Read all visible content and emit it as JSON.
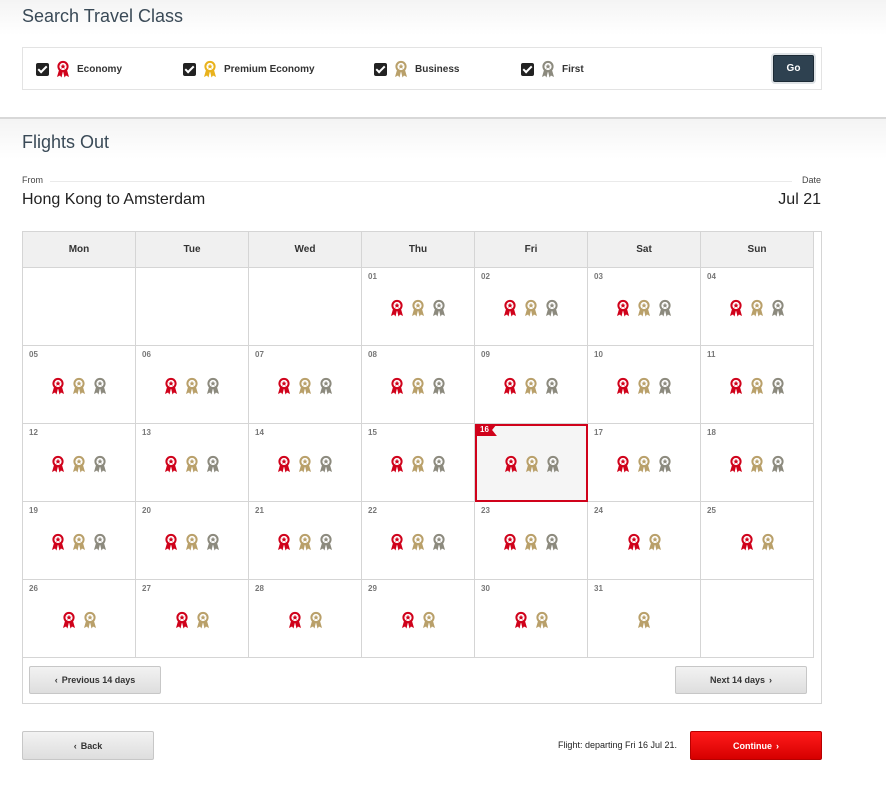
{
  "travel_class": {
    "title": "Search Travel Class",
    "options": [
      {
        "label": "Economy",
        "checked": true,
        "medal": "economy"
      },
      {
        "label": "Premium Economy",
        "checked": true,
        "medal": "premium"
      },
      {
        "label": "Business",
        "checked": true,
        "medal": "business"
      },
      {
        "label": "First",
        "checked": true,
        "medal": "first"
      }
    ],
    "go_label": "Go"
  },
  "flights": {
    "title": "Flights Out",
    "from_label": "From",
    "date_label": "Date",
    "route": "Hong Kong to Amsterdam",
    "month": "Jul 21"
  },
  "calendar": {
    "weekdays": [
      "Mon",
      "Tue",
      "Wed",
      "Thu",
      "Fri",
      "Sat",
      "Sun"
    ],
    "first_weekday_index": 3,
    "selected_day": "16",
    "days": [
      {
        "day": "01",
        "classes": [
          "economy",
          "business",
          "first"
        ]
      },
      {
        "day": "02",
        "classes": [
          "economy",
          "business",
          "first"
        ]
      },
      {
        "day": "03",
        "classes": [
          "economy",
          "business",
          "first"
        ]
      },
      {
        "day": "04",
        "classes": [
          "economy",
          "business",
          "first"
        ]
      },
      {
        "day": "05",
        "classes": [
          "economy",
          "business",
          "first"
        ]
      },
      {
        "day": "06",
        "classes": [
          "economy",
          "business",
          "first"
        ]
      },
      {
        "day": "07",
        "classes": [
          "economy",
          "business",
          "first"
        ]
      },
      {
        "day": "08",
        "classes": [
          "economy",
          "business",
          "first"
        ]
      },
      {
        "day": "09",
        "classes": [
          "economy",
          "business",
          "first"
        ]
      },
      {
        "day": "10",
        "classes": [
          "economy",
          "business",
          "first"
        ]
      },
      {
        "day": "11",
        "classes": [
          "economy",
          "business",
          "first"
        ]
      },
      {
        "day": "12",
        "classes": [
          "economy",
          "business",
          "first"
        ]
      },
      {
        "day": "13",
        "classes": [
          "economy",
          "business",
          "first"
        ]
      },
      {
        "day": "14",
        "classes": [
          "economy",
          "business",
          "first"
        ]
      },
      {
        "day": "15",
        "classes": [
          "economy",
          "business",
          "first"
        ]
      },
      {
        "day": "16",
        "classes": [
          "economy",
          "business",
          "first"
        ]
      },
      {
        "day": "17",
        "classes": [
          "economy",
          "business",
          "first"
        ]
      },
      {
        "day": "18",
        "classes": [
          "economy",
          "business",
          "first"
        ]
      },
      {
        "day": "19",
        "classes": [
          "economy",
          "business",
          "first"
        ]
      },
      {
        "day": "20",
        "classes": [
          "economy",
          "business",
          "first"
        ]
      },
      {
        "day": "21",
        "classes": [
          "economy",
          "business",
          "first"
        ]
      },
      {
        "day": "22",
        "classes": [
          "economy",
          "business",
          "first"
        ]
      },
      {
        "day": "23",
        "classes": [
          "economy",
          "business",
          "first"
        ]
      },
      {
        "day": "24",
        "classes": [
          "economy",
          "business"
        ]
      },
      {
        "day": "25",
        "classes": [
          "economy",
          "business"
        ]
      },
      {
        "day": "26",
        "classes": [
          "economy",
          "business"
        ]
      },
      {
        "day": "27",
        "classes": [
          "economy",
          "business"
        ]
      },
      {
        "day": "28",
        "classes": [
          "economy",
          "business"
        ]
      },
      {
        "day": "29",
        "classes": [
          "economy",
          "business"
        ]
      },
      {
        "day": "30",
        "classes": [
          "economy",
          "business"
        ]
      },
      {
        "day": "31",
        "classes": [
          "business"
        ]
      }
    ],
    "prev_label": "Previous 14 days",
    "next_label": "Next 14 days"
  },
  "footer": {
    "back_label": "Back",
    "status_text": "Flight: departing Fri 16 Jul 21.",
    "continue_label": "Continue"
  },
  "colors": {
    "economy": "#d0021b",
    "premium": "#e9b21c",
    "business": "#b9a06a",
    "first": "#8c8a7e",
    "accent_red": "#e00000",
    "go_button": "#2e4150"
  }
}
